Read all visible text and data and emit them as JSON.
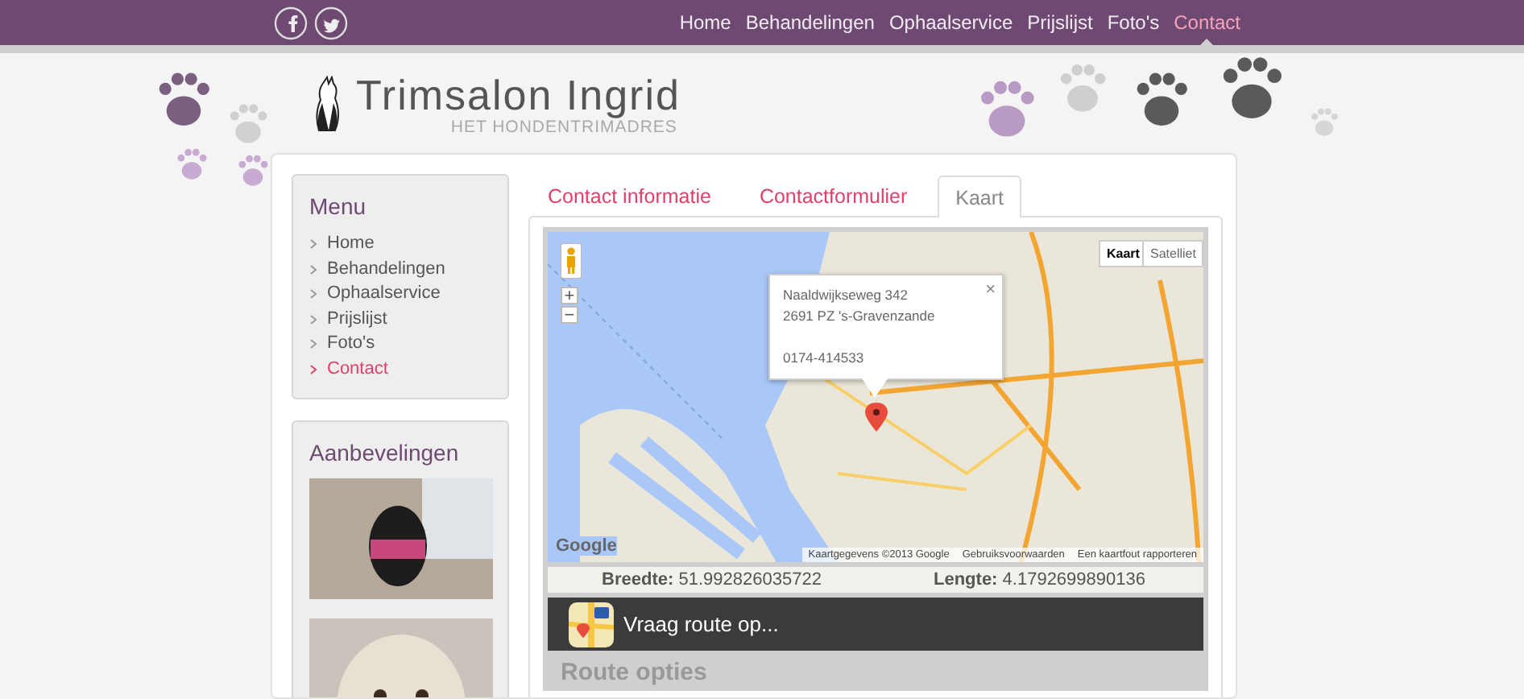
{
  "social_links": [
    {
      "kind": "facebook"
    },
    {
      "kind": "twitter"
    }
  ],
  "nav": [
    {
      "label": "Home",
      "selected": false
    },
    {
      "label": "Behandelingen",
      "selected": false
    },
    {
      "label": "Ophaalservice",
      "selected": false
    },
    {
      "label": "Prijslijst",
      "selected": false
    },
    {
      "label": "Foto's",
      "selected": false
    },
    {
      "label": "Contact",
      "selected": true
    }
  ],
  "site": {
    "title": "Trimsalon Ingrid",
    "subtitle": "HET HONDENTRIMADRES"
  },
  "sidebar": {
    "menu": {
      "title": "Menu",
      "items": [
        {
          "label": "Home",
          "selected": false
        },
        {
          "label": "Behandelingen",
          "selected": false
        },
        {
          "label": "Ophaalservice",
          "selected": false
        },
        {
          "label": "Prijslijst",
          "selected": false
        },
        {
          "label": "Foto's",
          "selected": false
        },
        {
          "label": "Contact",
          "selected": true
        }
      ]
    },
    "recommendations": {
      "title": "Aanbevelingen"
    }
  },
  "tabs": [
    {
      "label": "Contact informatie",
      "selected": false
    },
    {
      "label": "Contactformulier",
      "selected": false
    },
    {
      "label": "Kaart",
      "selected": true
    }
  ],
  "map": {
    "map_type_buttons": [
      {
        "label": "Kaart",
        "selected": true
      },
      {
        "label": "Satelliet",
        "selected": false
      }
    ],
    "zoom_in": "+",
    "zoom_out": "−",
    "info_window": {
      "address_lines": [
        "Naaldwijkseweg 342",
        "2691 PZ 's-Gravenzande"
      ],
      "phone": "0174-414533",
      "close": "×"
    },
    "logo": "Google",
    "attribution": [
      "Kaartgegevens ©2013 Google",
      "Gebruiksvoorwaarden",
      "Een kaartfout rapporteren"
    ]
  },
  "coordinates": [
    {
      "label": "Breedte:",
      "value": "51.992826035722"
    },
    {
      "label": "Lengte:",
      "value": "4.1792699890136"
    }
  ],
  "route_button": "Vraag route op...",
  "route_options_heading": "Route opties"
}
